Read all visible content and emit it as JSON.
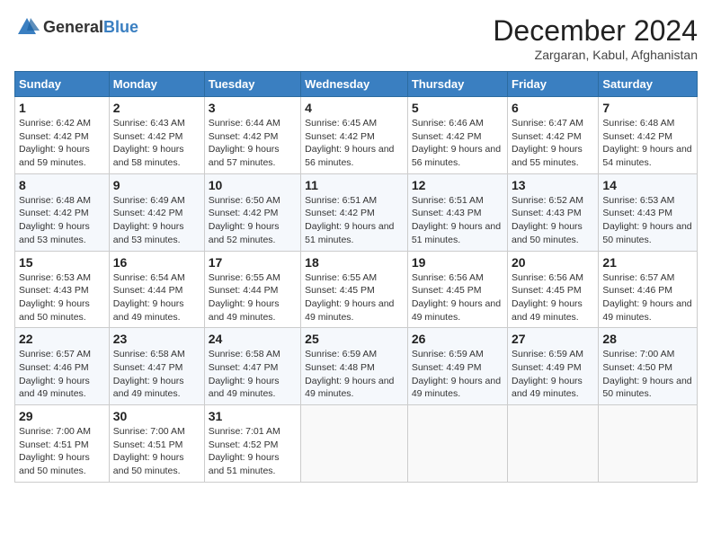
{
  "header": {
    "logo_general": "General",
    "logo_blue": "Blue",
    "title": "December 2024",
    "subtitle": "Zargaran, Kabul, Afghanistan"
  },
  "calendar": {
    "weekdays": [
      "Sunday",
      "Monday",
      "Tuesday",
      "Wednesday",
      "Thursday",
      "Friday",
      "Saturday"
    ],
    "weeks": [
      [
        {
          "day": "1",
          "sunrise": "6:42 AM",
          "sunset": "4:42 PM",
          "daylight": "9 hours and 59 minutes."
        },
        {
          "day": "2",
          "sunrise": "6:43 AM",
          "sunset": "4:42 PM",
          "daylight": "9 hours and 58 minutes."
        },
        {
          "day": "3",
          "sunrise": "6:44 AM",
          "sunset": "4:42 PM",
          "daylight": "9 hours and 57 minutes."
        },
        {
          "day": "4",
          "sunrise": "6:45 AM",
          "sunset": "4:42 PM",
          "daylight": "9 hours and 56 minutes."
        },
        {
          "day": "5",
          "sunrise": "6:46 AM",
          "sunset": "4:42 PM",
          "daylight": "9 hours and 56 minutes."
        },
        {
          "day": "6",
          "sunrise": "6:47 AM",
          "sunset": "4:42 PM",
          "daylight": "9 hours and 55 minutes."
        },
        {
          "day": "7",
          "sunrise": "6:48 AM",
          "sunset": "4:42 PM",
          "daylight": "9 hours and 54 minutes."
        }
      ],
      [
        {
          "day": "8",
          "sunrise": "6:48 AM",
          "sunset": "4:42 PM",
          "daylight": "9 hours and 53 minutes."
        },
        {
          "day": "9",
          "sunrise": "6:49 AM",
          "sunset": "4:42 PM",
          "daylight": "9 hours and 53 minutes."
        },
        {
          "day": "10",
          "sunrise": "6:50 AM",
          "sunset": "4:42 PM",
          "daylight": "9 hours and 52 minutes."
        },
        {
          "day": "11",
          "sunrise": "6:51 AM",
          "sunset": "4:42 PM",
          "daylight": "9 hours and 51 minutes."
        },
        {
          "day": "12",
          "sunrise": "6:51 AM",
          "sunset": "4:43 PM",
          "daylight": "9 hours and 51 minutes."
        },
        {
          "day": "13",
          "sunrise": "6:52 AM",
          "sunset": "4:43 PM",
          "daylight": "9 hours and 50 minutes."
        },
        {
          "day": "14",
          "sunrise": "6:53 AM",
          "sunset": "4:43 PM",
          "daylight": "9 hours and 50 minutes."
        }
      ],
      [
        {
          "day": "15",
          "sunrise": "6:53 AM",
          "sunset": "4:43 PM",
          "daylight": "9 hours and 50 minutes."
        },
        {
          "day": "16",
          "sunrise": "6:54 AM",
          "sunset": "4:44 PM",
          "daylight": "9 hours and 49 minutes."
        },
        {
          "day": "17",
          "sunrise": "6:55 AM",
          "sunset": "4:44 PM",
          "daylight": "9 hours and 49 minutes."
        },
        {
          "day": "18",
          "sunrise": "6:55 AM",
          "sunset": "4:45 PM",
          "daylight": "9 hours and 49 minutes."
        },
        {
          "day": "19",
          "sunrise": "6:56 AM",
          "sunset": "4:45 PM",
          "daylight": "9 hours and 49 minutes."
        },
        {
          "day": "20",
          "sunrise": "6:56 AM",
          "sunset": "4:45 PM",
          "daylight": "9 hours and 49 minutes."
        },
        {
          "day": "21",
          "sunrise": "6:57 AM",
          "sunset": "4:46 PM",
          "daylight": "9 hours and 49 minutes."
        }
      ],
      [
        {
          "day": "22",
          "sunrise": "6:57 AM",
          "sunset": "4:46 PM",
          "daylight": "9 hours and 49 minutes."
        },
        {
          "day": "23",
          "sunrise": "6:58 AM",
          "sunset": "4:47 PM",
          "daylight": "9 hours and 49 minutes."
        },
        {
          "day": "24",
          "sunrise": "6:58 AM",
          "sunset": "4:47 PM",
          "daylight": "9 hours and 49 minutes."
        },
        {
          "day": "25",
          "sunrise": "6:59 AM",
          "sunset": "4:48 PM",
          "daylight": "9 hours and 49 minutes."
        },
        {
          "day": "26",
          "sunrise": "6:59 AM",
          "sunset": "4:49 PM",
          "daylight": "9 hours and 49 minutes."
        },
        {
          "day": "27",
          "sunrise": "6:59 AM",
          "sunset": "4:49 PM",
          "daylight": "9 hours and 49 minutes."
        },
        {
          "day": "28",
          "sunrise": "7:00 AM",
          "sunset": "4:50 PM",
          "daylight": "9 hours and 50 minutes."
        }
      ],
      [
        {
          "day": "29",
          "sunrise": "7:00 AM",
          "sunset": "4:51 PM",
          "daylight": "9 hours and 50 minutes."
        },
        {
          "day": "30",
          "sunrise": "7:00 AM",
          "sunset": "4:51 PM",
          "daylight": "9 hours and 50 minutes."
        },
        {
          "day": "31",
          "sunrise": "7:01 AM",
          "sunset": "4:52 PM",
          "daylight": "9 hours and 51 minutes."
        },
        null,
        null,
        null,
        null
      ]
    ]
  }
}
